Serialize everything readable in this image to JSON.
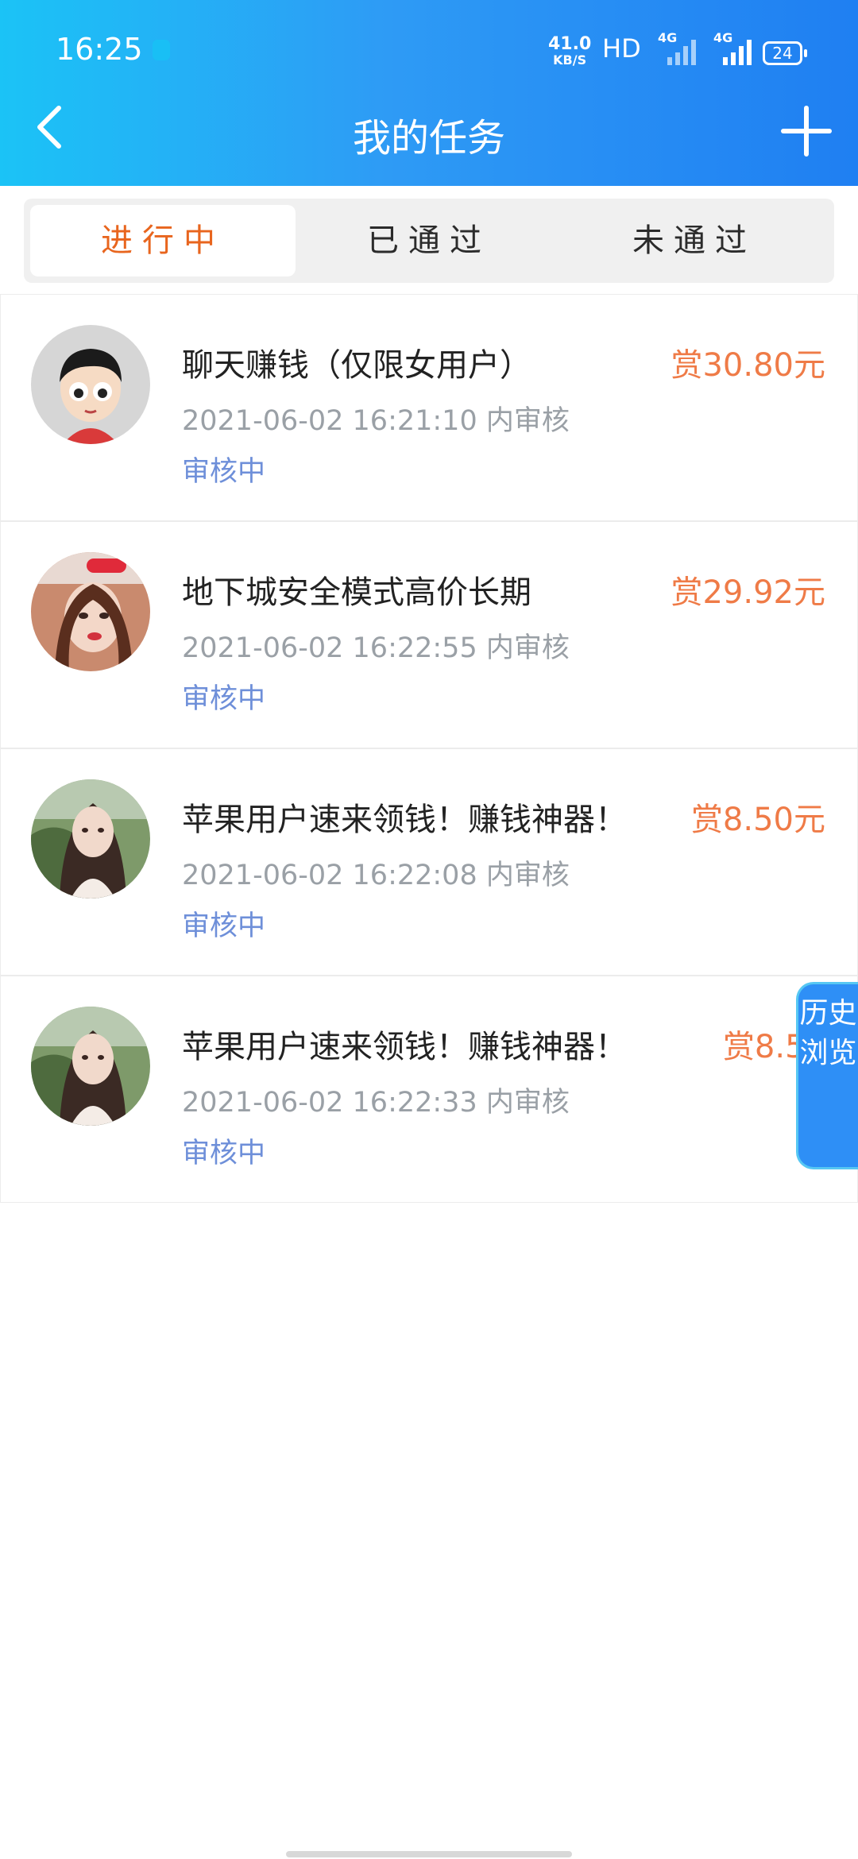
{
  "status_bar": {
    "time": "16:25",
    "net_speed": "41.0",
    "net_unit": "KB/S",
    "hd": "HD",
    "signal1_label": "4G",
    "signal2_label": "4G",
    "battery": "24"
  },
  "header": {
    "title": "我的任务",
    "back_icon": "chevron-left-icon",
    "add_icon": "plus-icon"
  },
  "tabs": [
    {
      "label": "进行中",
      "active": true
    },
    {
      "label": "已通过",
      "active": false
    },
    {
      "label": "未通过",
      "active": false
    }
  ],
  "tasks": [
    {
      "title": "聊天赚钱（仅限女用户）",
      "reward": "赏30.80元",
      "time": "2021-06-02 16:21:10 内审核",
      "status": "审核中",
      "avatar": "cartoon-avatar"
    },
    {
      "title": "地下城安全模式高价长期",
      "reward": "赏29.92元",
      "time": "2021-06-02 16:22:55 内审核",
      "status": "审核中",
      "avatar": "photo-avatar"
    },
    {
      "title": "苹果用户速来领钱！赚钱神器！",
      "reward": "赏8.50元",
      "time": "2021-06-02 16:22:08 内审核",
      "status": "审核中",
      "avatar": "photo-avatar"
    },
    {
      "title": "苹果用户速来领钱！赚钱神器！",
      "reward": "赏8.50",
      "time": "2021-06-02 16:22:33 内审核",
      "status": "审核中",
      "avatar": "photo-avatar"
    }
  ],
  "history_button": {
    "label": "历史浏览"
  },
  "colors": {
    "accent": "#e8651e",
    "reward": "#ef7b47",
    "status": "#6e8fd9",
    "header": "#2e9bf5"
  }
}
